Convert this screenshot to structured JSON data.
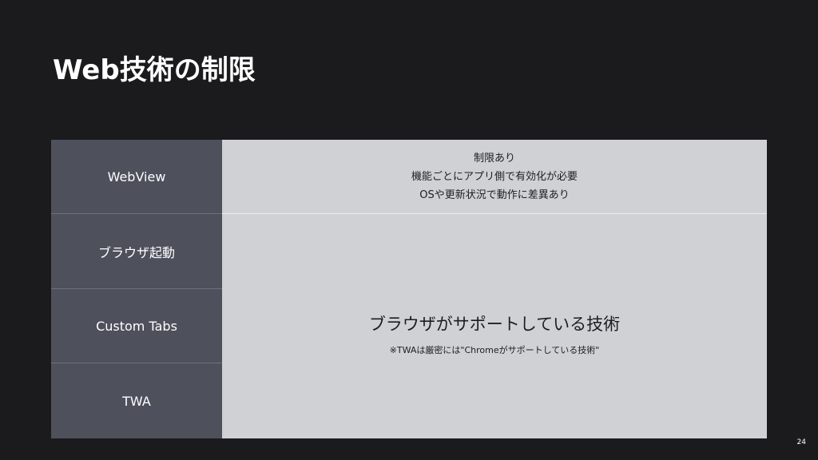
{
  "slide": {
    "title": "Web技術の制限",
    "page_number": "24"
  },
  "table": {
    "rows": [
      {
        "label": "WebView"
      },
      {
        "label": "ブラウザ起動"
      },
      {
        "label": "Custom Tabs"
      },
      {
        "label": "TWA"
      }
    ],
    "webview_notes": [
      "制限あり",
      "機能ごとにアプリ側で有効化が必要",
      "OSや更新状況で動作に差異あり"
    ],
    "browser_group": {
      "main": "ブラウザがサポートしている技術",
      "note": "※TWAは厳密には\"Chromeがサポートしている技術\""
    }
  },
  "colors": {
    "background": "#1b1b1d",
    "label_cell": "#4e515c",
    "content_cell": "#d0d1d4"
  }
}
